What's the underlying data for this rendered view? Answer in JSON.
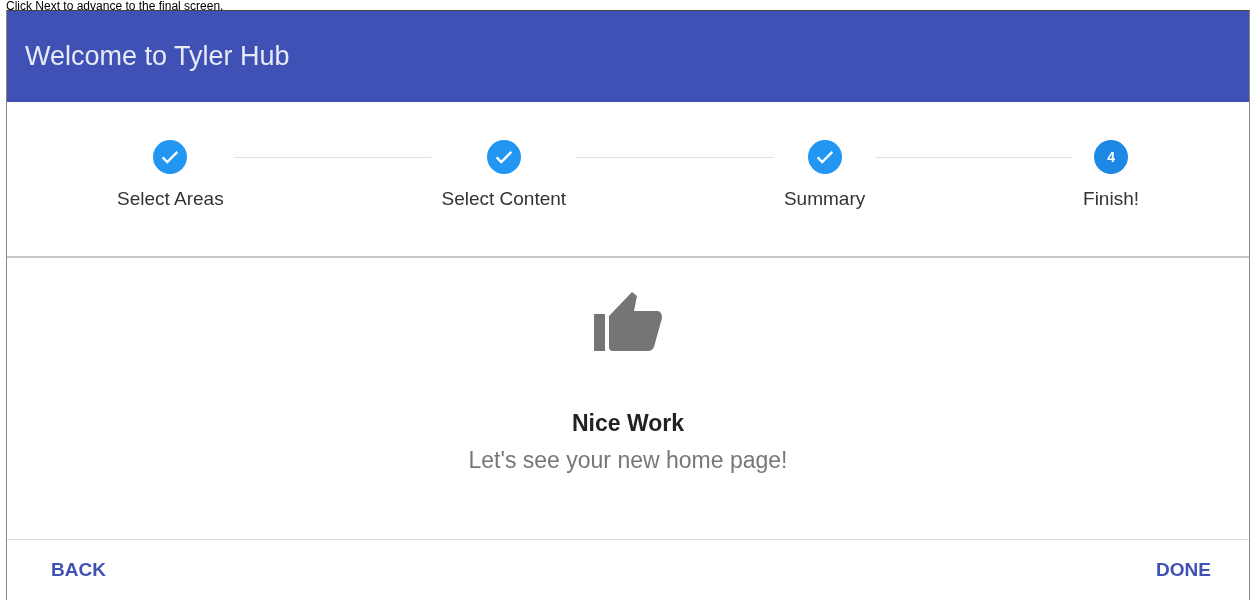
{
  "caption": "Click Next to advance to the final screen.",
  "dialog": {
    "title": "Welcome to Tyler Hub",
    "steps": [
      {
        "label": "Select Areas",
        "completed": true
      },
      {
        "label": "Select Content",
        "completed": true
      },
      {
        "label": "Summary",
        "completed": true
      },
      {
        "label": "Finish!",
        "number": "4",
        "completed": false
      }
    ],
    "message": {
      "heading": "Nice Work",
      "text": "Let's see your new home page!"
    },
    "buttons": [
      {
        "label": "BACK"
      },
      {
        "label": "DONE"
      }
    ]
  }
}
